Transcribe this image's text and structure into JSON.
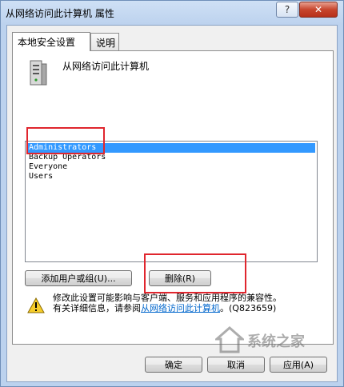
{
  "window": {
    "title": "从网络访问此计算机 属性",
    "help_label": "?",
    "close_label": "✕"
  },
  "tabs": [
    {
      "label": "本地安全设置"
    },
    {
      "label": "说明"
    }
  ],
  "policy": {
    "name": "从网络访问此计算机",
    "icon": "server-icon"
  },
  "list": {
    "items": [
      "Administrators",
      "Backup Operators",
      "Everyone",
      "Users"
    ],
    "selected_index": 0
  },
  "buttons": {
    "add": "添加用户或组(U)...",
    "remove": "删除(R)"
  },
  "warning": {
    "icon": "warning-icon",
    "line1": "修改此设置可能影响与客户端、服务和应用程序的兼容性。",
    "line2_prefix": "有关详细信息，请参阅",
    "line2_link": "从网络访问此计算机",
    "line2_suffix": "。(Q823659)"
  },
  "footer": {
    "ok": "确定",
    "cancel": "取消",
    "apply": "应用(A)"
  },
  "watermark": {
    "text": "系统之家"
  },
  "colors": {
    "highlight_box": "#e0262e",
    "selection": "#3399ff",
    "link": "#0066cc"
  }
}
